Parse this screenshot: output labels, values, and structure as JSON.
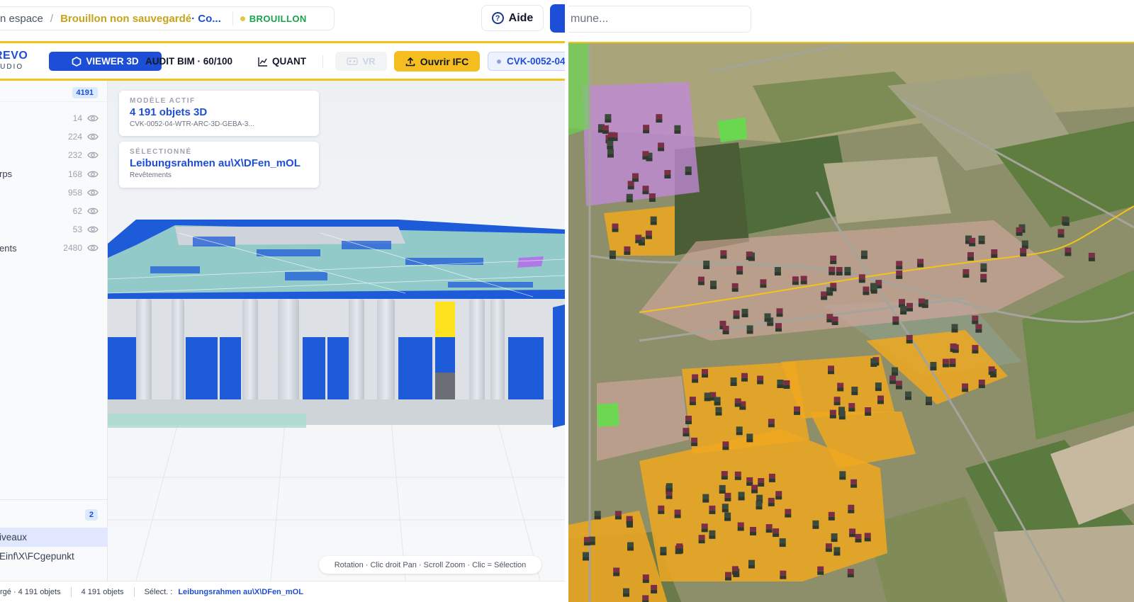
{
  "header": {
    "breadcrumb_workspace": "n espace",
    "breadcrumb_separator": "/",
    "breadcrumb_draft": "Brouillon non sauvegardé",
    "breadcrumb_project": " · Co...",
    "status_badge": "BROUILLON",
    "help_label": "Aide"
  },
  "toolbar": {
    "logo_main": "REVO",
    "logo_sub": "TUDIO",
    "viewer_tab": "VIEWER 3D",
    "audit_tab": "AUDIT BIM · 60/100",
    "quant_tab": "QUANT",
    "vr_tab": "VR",
    "open_ifc": "Ouvrir IFC",
    "model_code": "CVK-0052-04"
  },
  "sidebar": {
    "total": "4191",
    "groups": [
      {
        "name": "",
        "count": "14"
      },
      {
        "name": "",
        "count": "224"
      },
      {
        "name": "",
        "count": "232"
      },
      {
        "name": "rps",
        "count": "168"
      },
      {
        "name": "",
        "count": "958"
      },
      {
        "name": "",
        "count": "62"
      },
      {
        "name": "",
        "count": "53"
      },
      {
        "name": "ents",
        "count": "2480"
      }
    ],
    "levels_count": "2",
    "levels": [
      {
        "name": "iveaux"
      },
      {
        "name": "Einf\\X\\FCgepunkt"
      }
    ]
  },
  "viewer": {
    "active_label": "MODÈLE ACTIF",
    "active_title": "4 191 objets 3D",
    "active_file": "CVK-0052-04-WTR-ARC-3D-GEBA-3...",
    "selected_label": "SÉLECTIONNÉ",
    "selected_title": "Leibungsrahmen au\\X\\DFen_mOL",
    "selected_category": "Revêtements",
    "hint": "Rotation · Clic droit Pan · Scroll Zoom · Clic = Sélection"
  },
  "statusbar": {
    "left": "rgé · 4 191 objets",
    "count": "4 191 objets",
    "selection_label": "Sélect. :",
    "selection_value": "Leibungsrahmen au\\X\\DFen_mOL"
  },
  "map_pane": {
    "search_placeholder": "mune..."
  },
  "colors": {
    "accent_blue": "#1d4ed8",
    "accent_yellow": "#f5bd1f",
    "zone_orange": "#f0a820",
    "zone_purple": "#c48adf"
  }
}
